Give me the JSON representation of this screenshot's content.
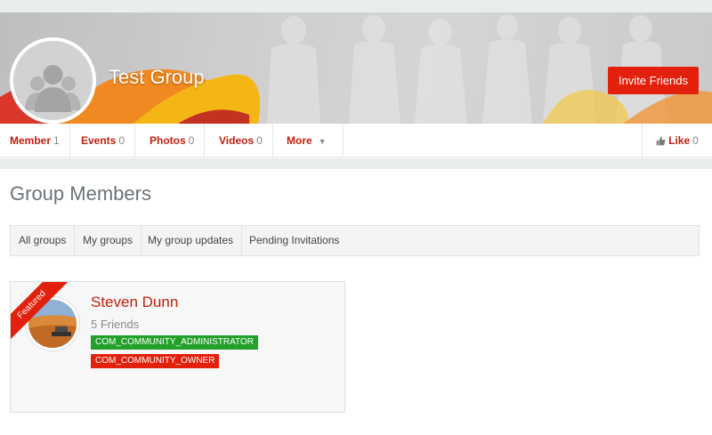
{
  "header": {
    "group_name": "Test Group",
    "invite_label": "Invite Friends"
  },
  "nav": {
    "items": [
      {
        "label": "Member",
        "count": "1"
      },
      {
        "label": "Events",
        "count": "0"
      },
      {
        "label": "Photos",
        "count": "0"
      },
      {
        "label": "Videos",
        "count": "0"
      },
      {
        "label": "More",
        "count": ""
      }
    ],
    "like": {
      "label": "Like",
      "count": "0"
    }
  },
  "main": {
    "title": "Group Members",
    "tabs": [
      "All groups",
      "My groups",
      "My group updates",
      "Pending Invitations"
    ]
  },
  "member": {
    "ribbon": "Featured",
    "name": "Steven Dunn",
    "friends": "5 Friends",
    "badges": [
      "COM_COMMUNITY_ADMINISTRATOR",
      "COM_COMMUNITY_OWNER"
    ]
  },
  "colors": {
    "accent": "#e3200b",
    "link": "#c0200e",
    "badge_green": "#22a02a",
    "page_bg": "#e9edee"
  },
  "icons": {
    "like": "thumbs-up-icon",
    "more": "chevron-down-icon",
    "avatar": "group-avatar-icon"
  }
}
